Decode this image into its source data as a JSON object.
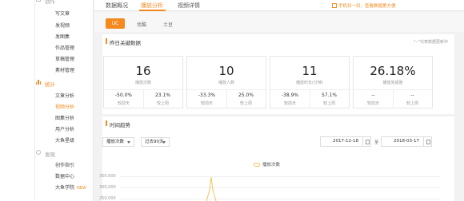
{
  "sidebar": {
    "groups": [
      {
        "label": "创作",
        "items": [
          "写文章",
          "发视频",
          "发图集",
          "作品管理",
          "草稿管理",
          "素材管理"
        ]
      },
      {
        "label": "统计",
        "items": [
          "文章分析",
          "视频分析",
          "图集分析",
          "用户分析",
          "大鱼星级"
        ]
      },
      {
        "label": "发现",
        "items": [
          "创作指引",
          "数据中心",
          "大鱼学院"
        ]
      }
    ],
    "active_group": "统计",
    "active_item": "视频分析",
    "new_badge": "NEW"
  },
  "topbar": {
    "tabs": [
      "数据概况",
      "播放分析",
      "视频详情"
    ],
    "active_tab": "播放分析",
    "notice": "手机扫一扫，查看数据更方便"
  },
  "subtabs": [
    "UC",
    "优酷",
    "土豆"
  ],
  "yesterday": {
    "title": "昨日关键数据",
    "note": "\"--\"代表数据更新中",
    "cards": [
      {
        "value": "16",
        "label": "播放次数",
        "cmp1": "-50.0%",
        "cmp1_label": "较前天",
        "cmp2": "23.1%",
        "cmp2_label": "较上周"
      },
      {
        "value": "10",
        "label": "播放人数",
        "cmp1": "-33.3%",
        "cmp1_label": "较前天",
        "cmp2": "25.0%",
        "cmp2_label": "较上周"
      },
      {
        "value": "11",
        "label": "播放时长(分钟)",
        "cmp1": "-38.9%",
        "cmp1_label": "较前天",
        "cmp2": "57.1%",
        "cmp2_label": "较上周"
      },
      {
        "value": "26.18%",
        "label": "播放完成度",
        "cmp1": "--",
        "cmp1_label": "较前天",
        "cmp2": "--",
        "cmp2_label": "较上周"
      }
    ]
  },
  "trend": {
    "title": "时间趋势",
    "metric": "播放次数",
    "range": "过去90天",
    "start_date": "2017-12-18",
    "to": "至",
    "end_date": "2018-03-17",
    "legend": "播放次数"
  },
  "chart_data": {
    "type": "line",
    "series": [
      {
        "name": "播放次数",
        "color": "#f3c45a"
      }
    ],
    "y_ticks": [
      "350,000",
      "300,000",
      "250,000"
    ],
    "ylim": [
      0,
      350000
    ]
  },
  "colors": {
    "accent": "#f4891f",
    "series": "#f3c45a"
  }
}
